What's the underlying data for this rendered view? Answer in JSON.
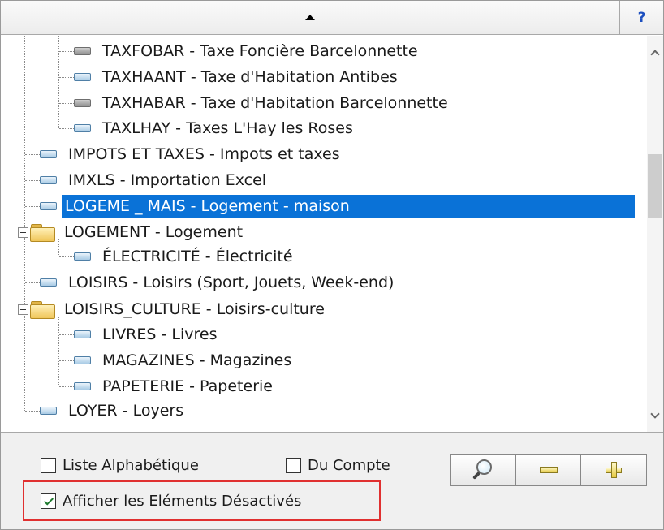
{
  "toolbar_top": {
    "help_label": "?"
  },
  "tree": {
    "items": [
      {
        "label": "TAXFOBAR - Taxe Foncière Barcelonnette",
        "icon": "gray-leaf-icon"
      },
      {
        "label": "TAXHAANT - Taxe d'Habitation Antibes",
        "icon": "blue-leaf-icon"
      },
      {
        "label": "TAXHABAR - Taxe d'Habitation Barcelonnette",
        "icon": "gray-leaf-icon"
      },
      {
        "label": "TAXLHAY - Taxes L'Hay les Roses",
        "icon": "blue-leaf-icon"
      },
      {
        "label": "IMPOTS ET TAXES - Impots et taxes",
        "icon": "blue-leaf-icon"
      },
      {
        "label": "IMXLS - Importation Excel",
        "icon": "blue-leaf-icon"
      },
      {
        "label": "LOGEME _ MAIS - Logement - maison",
        "icon": "blue-leaf-icon",
        "selected": true
      },
      {
        "label": "LOGEMENT - Logement",
        "icon": "folder-icon"
      },
      {
        "label": "ÉLECTRICITÉ - Électricité",
        "icon": "blue-leaf-icon"
      },
      {
        "label": "LOISIRS - Loisirs (Sport, Jouets, Week-end)",
        "icon": "blue-leaf-icon"
      },
      {
        "label": "LOISIRS_CULTURE - Loisirs-culture",
        "icon": "folder-icon"
      },
      {
        "label": "LIVRES - Livres",
        "icon": "blue-leaf-icon"
      },
      {
        "label": "MAGAZINES - Magazines",
        "icon": "blue-leaf-icon"
      },
      {
        "label": "PAPETERIE - Papeterie",
        "icon": "blue-leaf-icon"
      },
      {
        "label": "LOYER - Loyers",
        "icon": "blue-leaf-icon"
      }
    ]
  },
  "options": {
    "alpha_label": "Liste Alphabétique",
    "alpha_checked": false,
    "account_label": "Du Compte",
    "account_checked": false,
    "disabled_label": "Afficher les Eléments Désactivés",
    "disabled_checked": true
  },
  "actions": {
    "search_icon": "magnifier-icon",
    "collapse_icon": "minus-icon",
    "expand_icon": "plus-icon"
  },
  "colors": {
    "selection": "#0a72d7",
    "highlight_frame": "#e03030",
    "help": "#1c4fbf"
  }
}
